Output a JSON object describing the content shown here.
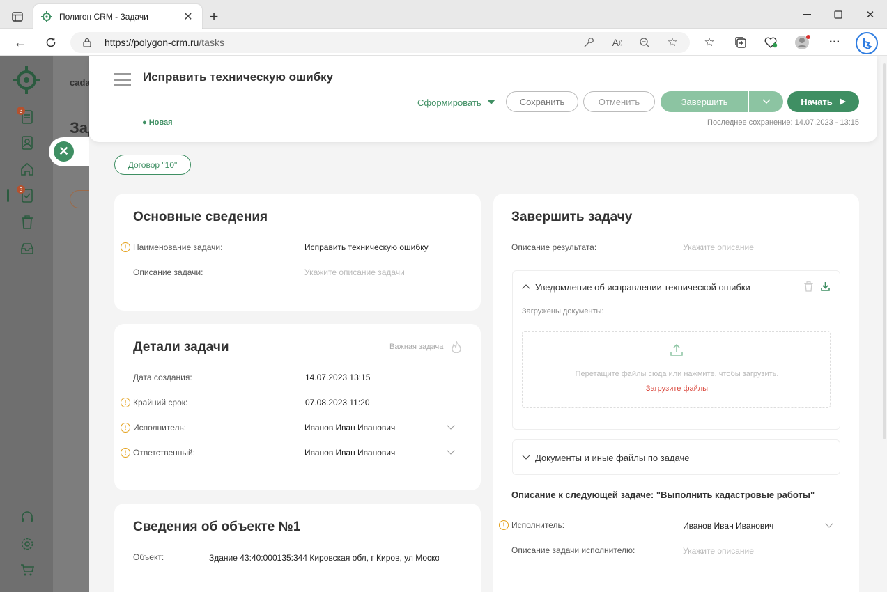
{
  "browser": {
    "tab_title": "Полигон CRM - Задачи",
    "url_base": "https://polygon-crm.ru",
    "url_path": "/tasks"
  },
  "sidebar": {
    "items": [
      {
        "icon": "documents-icon",
        "badge": "3"
      },
      {
        "icon": "contacts-icon"
      },
      {
        "icon": "home-icon"
      },
      {
        "icon": "tasks-icon",
        "badge": "3",
        "active": true
      },
      {
        "icon": "trash-icon"
      },
      {
        "icon": "inbox-icon"
      }
    ],
    "bottom": [
      "headset-icon",
      "settings-icon",
      "cart-icon"
    ]
  },
  "background_page": {
    "top_text": "cada",
    "title": "Зад"
  },
  "header": {
    "title": "Исправить техническую ошибку",
    "status": "Новая",
    "generate_label": "Сформировать",
    "save_label": "Сохранить",
    "cancel_label": "Отменить",
    "complete_label": "Завершить",
    "start_label": "Начать",
    "last_saved": "Последнее сохранение: 14.07.2023 - 13:15"
  },
  "contract_tag": "Договор \"10\"",
  "basic_info": {
    "title": "Основные сведения",
    "name_label": "Наименование задачи:",
    "name_value": "Исправить техническую ошибку",
    "desc_label": "Описание задачи:",
    "desc_placeholder": "Укажите описание задачи"
  },
  "details": {
    "title": "Детали задачи",
    "important_label": "Важная задача",
    "created_label": "Дата создания:",
    "created_value": "14.07.2023 13:15",
    "deadline_label": "Крайний срок:",
    "deadline_value": "07.08.2023 11:20",
    "executor_label": "Исполнитель:",
    "executor_value": "Иванов Иван Иванович",
    "responsible_label": "Ответственный:",
    "responsible_value": "Иванов Иван Иванович"
  },
  "object_info": {
    "title": "Сведения об объекте №1",
    "object_label": "Объект:",
    "object_value": "Здание 43:40:000135:344 Кировская обл, г Киров, ул Моско"
  },
  "complete_task": {
    "title": "Завершить задачу",
    "result_label": "Описание результата:",
    "result_placeholder": "Укажите описание",
    "notice_title": "Уведомление об исправлении технической ошибки",
    "uploaded_label": "Загружены документы:",
    "drop_text": "Перетащите файлы сюда или нажмите, чтобы загрузить.",
    "upload_link": "Загрузите файлы",
    "docs_title": "Документы и иные файлы по задаче",
    "next_task_title": "Описание к следующей задаче: \"Выполнить кадастровые работы\"",
    "next_executor_label": "Исполнитель:",
    "next_executor_value": "Иванов Иван Иванович",
    "next_desc_label": "Описание задачи исполнителю:",
    "next_desc_placeholder": "Укажите описание"
  },
  "colors": {
    "brand": "#3f8f63",
    "brand_light": "#8cc4a2",
    "warn": "#e4a21f",
    "link_red": "#d9453a"
  }
}
